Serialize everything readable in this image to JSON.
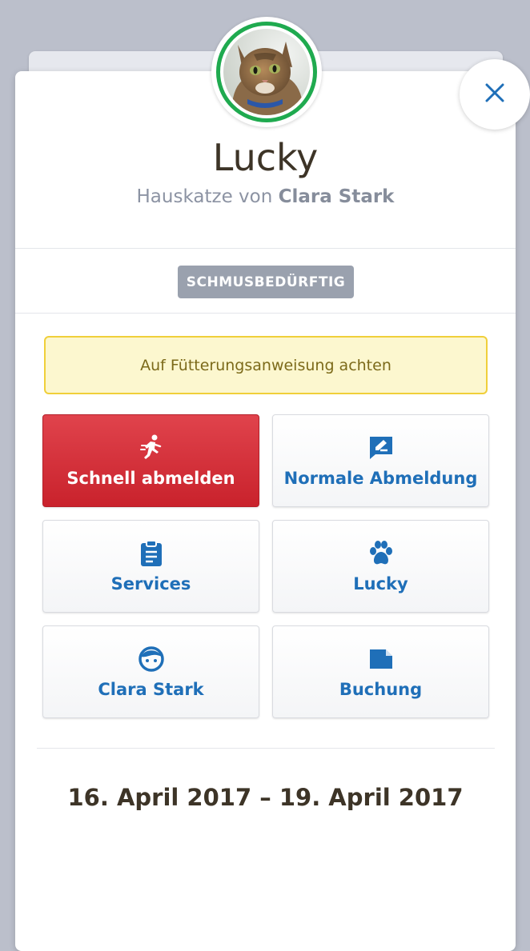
{
  "pet": {
    "name": "Lucky",
    "subtitle_prefix": "Hauskatze von",
    "owner": "Clara Stark"
  },
  "tag": "SCHMUSBEDÜRFTIG",
  "notice": "Auf Fütterungsanweisung achten",
  "actions": [
    {
      "label": "Schnell abmelden",
      "icon": "running-person-icon"
    },
    {
      "label": "Normale Abmeldung",
      "icon": "edit-message-icon"
    },
    {
      "label": "Services",
      "icon": "clipboard-icon"
    },
    {
      "label": "Lucky",
      "icon": "paw-icon"
    },
    {
      "label": "Clara Stark",
      "icon": "face-icon"
    },
    {
      "label": "Buchung",
      "icon": "note-icon"
    }
  ],
  "date_range": "16. April 2017 – 19. April 2017",
  "colors": {
    "accent": "#1f6fb8",
    "danger": "#d2313a",
    "avatar_ring": "#1faa4f",
    "tag_bg": "#9aa1ae",
    "notice_bg": "#fcf7cf",
    "notice_border": "#f0cf3a"
  }
}
